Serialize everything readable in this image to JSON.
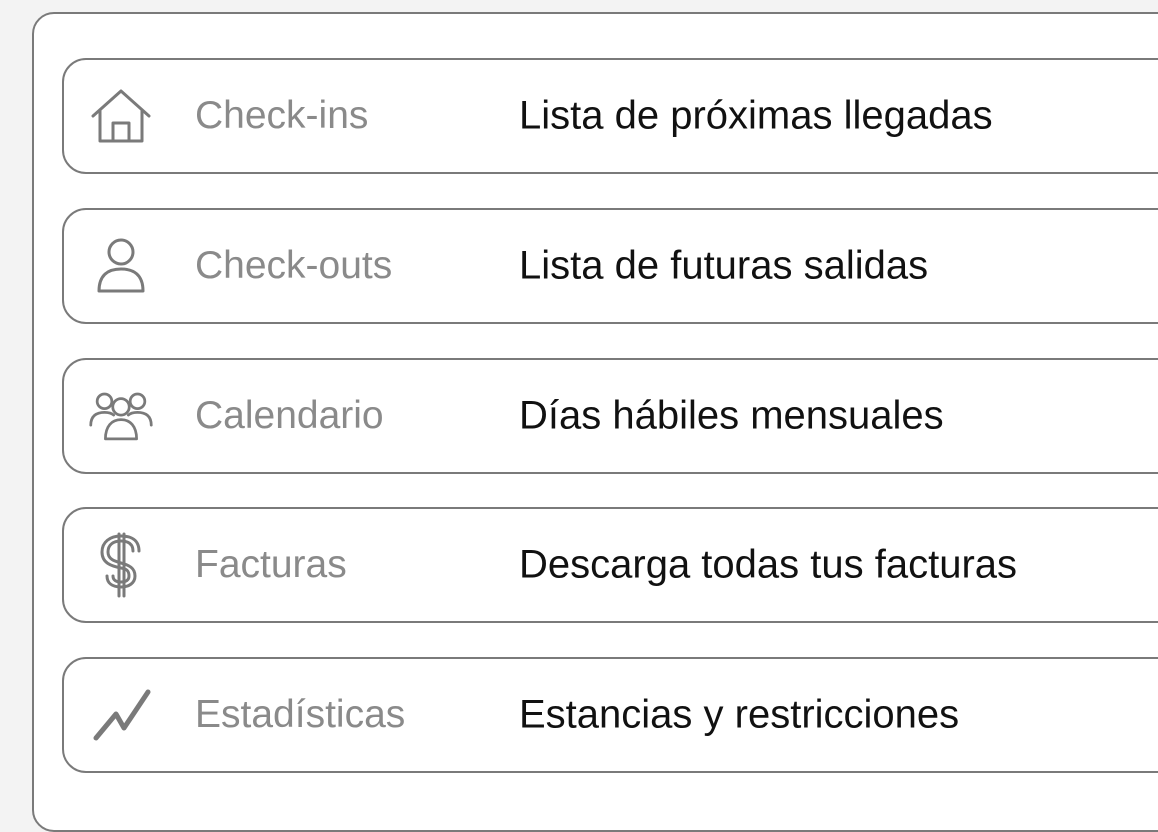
{
  "menu": {
    "items": [
      {
        "icon": "home-icon",
        "label": "Check-ins",
        "description": "Lista de próximas llegadas"
      },
      {
        "icon": "user-icon",
        "label": "Check-outs",
        "description": "Lista de futuras salidas"
      },
      {
        "icon": "users-group-icon",
        "label": "Calendario",
        "description": "Días hábiles mensuales"
      },
      {
        "icon": "dollar-icon",
        "label": "Facturas",
        "description": "Descarga todas tus facturas"
      },
      {
        "icon": "trend-line-icon",
        "label": "Estadísticas",
        "description": "Estancias y restricciones"
      }
    ]
  },
  "colors": {
    "border": "#7a7a7a",
    "label": "#8a8a8a",
    "description": "#111111",
    "icon": "#7a7a7a",
    "background": "#f3f3f3",
    "panel": "#ffffff"
  }
}
